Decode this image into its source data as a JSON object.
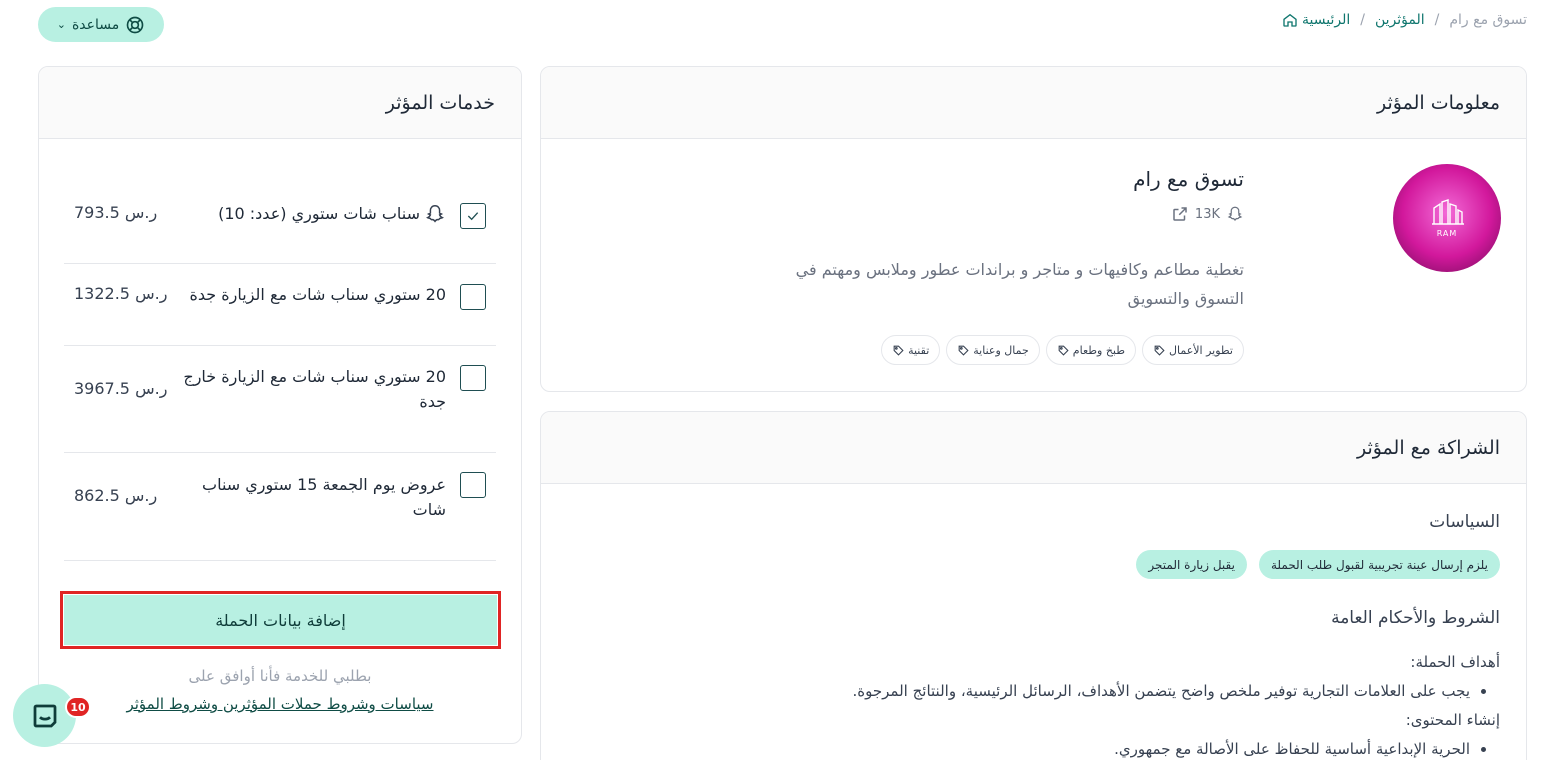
{
  "breadcrumb": {
    "home": "الرئيسية",
    "influencers": "المؤثرين",
    "current": "تسوق مع رام"
  },
  "help": {
    "label": "مساعدة"
  },
  "info_card": {
    "title": "معلومات المؤثر",
    "name": "تسوق مع رام",
    "followers": "13K",
    "bio": "تغطية مطاعم وكافيهات و متاجر و براندات عطور وملابس ومهتم في التسوق والتسويق",
    "avatar_text": "RAM",
    "tags": [
      "تطوير الأعمال",
      "طبخ وطعام",
      "جمال وعناية",
      "تقنية"
    ]
  },
  "partner_card": {
    "title": "الشراكة مع المؤثر",
    "policies_title": "السياسات",
    "policies": [
      "يلزم إرسال عينة تجريبية لقبول طلب الحملة",
      "يقبل زيارة المتجر"
    ],
    "terms_title": "الشروط والأحكام العامة",
    "goals_heading": "أهداف الحملة:",
    "goals_item": "يجب على العلامات التجارية توفير ملخص واضح يتضمن الأهداف، الرسائل الرئيسية، والنتائج المرجوة.",
    "content_heading": "إنشاء المحتوى:",
    "content_item": "الحرية الإبداعية أساسية للحفاظ على الأصالة مع جمهوري."
  },
  "services_card": {
    "title": "خدمات المؤثر",
    "items": [
      {
        "label": "سناب شات ستوري (عدد: 10)",
        "price": "793.5 ر.س",
        "checked": true
      },
      {
        "label": "20 ستوري سناب شات مع الزيارة جدة",
        "price": "1322.5 ر.س",
        "checked": false
      },
      {
        "label": "20 ستوري سناب شات مع الزيارة خارج جدة",
        "price": "3967.5 ر.س",
        "checked": false
      },
      {
        "label": "عروض يوم الجمعة 15 ستوري سناب شات",
        "price": "862.5 ر.س",
        "checked": false
      }
    ],
    "cta": "إضافة بيانات الحملة",
    "agree_text": "بطلبي للخدمة فأنا أوافق على",
    "agree_link": "سياسات وشروط حملات المؤثرين وشروط المؤثر"
  },
  "chat": {
    "badge": "10"
  },
  "colors": {
    "accent": "#b8f0e2",
    "highlight_border": "#e02424",
    "link": "#0f766e"
  },
  "icons": [
    "home-icon",
    "lifebuoy-icon",
    "chevron-down-icon",
    "snapchat-icon",
    "external-link-icon",
    "tag-icon",
    "check-icon",
    "chat-icon"
  ]
}
